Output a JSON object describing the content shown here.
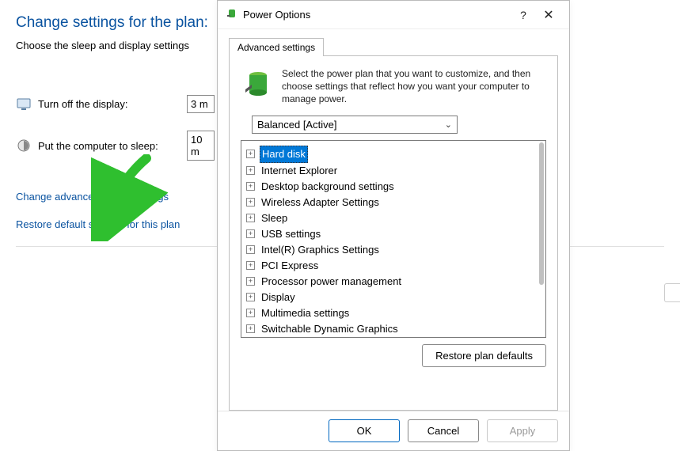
{
  "bg": {
    "title": "Change settings for the plan:",
    "subtitle": "Choose the sleep and display settings",
    "row1_label": "Turn off the display:",
    "row1_value": "3 m",
    "row2_label": "Put the computer to sleep:",
    "row2_value": "10 m",
    "link_adv": "Change advanced power settings",
    "link_restore": "Restore default settings for this plan"
  },
  "dlg": {
    "title": "Power Options",
    "help_glyph": "?",
    "close_glyph": "✕",
    "tab": "Advanced settings",
    "info_text": "Select the power plan that you want to customize, and then choose settings that reflect how you want your computer to manage power.",
    "plan": "Balanced [Active]",
    "restore_btn": "Restore plan defaults",
    "ok": "OK",
    "cancel": "Cancel",
    "apply": "Apply"
  },
  "tree": [
    {
      "label": "Hard disk",
      "selected": true
    },
    {
      "label": "Internet Explorer"
    },
    {
      "label": "Desktop background settings"
    },
    {
      "label": "Wireless Adapter Settings"
    },
    {
      "label": "Sleep"
    },
    {
      "label": "USB settings"
    },
    {
      "label": "Intel(R) Graphics Settings"
    },
    {
      "label": "PCI Express"
    },
    {
      "label": "Processor power management"
    },
    {
      "label": "Display"
    },
    {
      "label": "Multimedia settings"
    },
    {
      "label": "Switchable Dynamic Graphics"
    }
  ]
}
